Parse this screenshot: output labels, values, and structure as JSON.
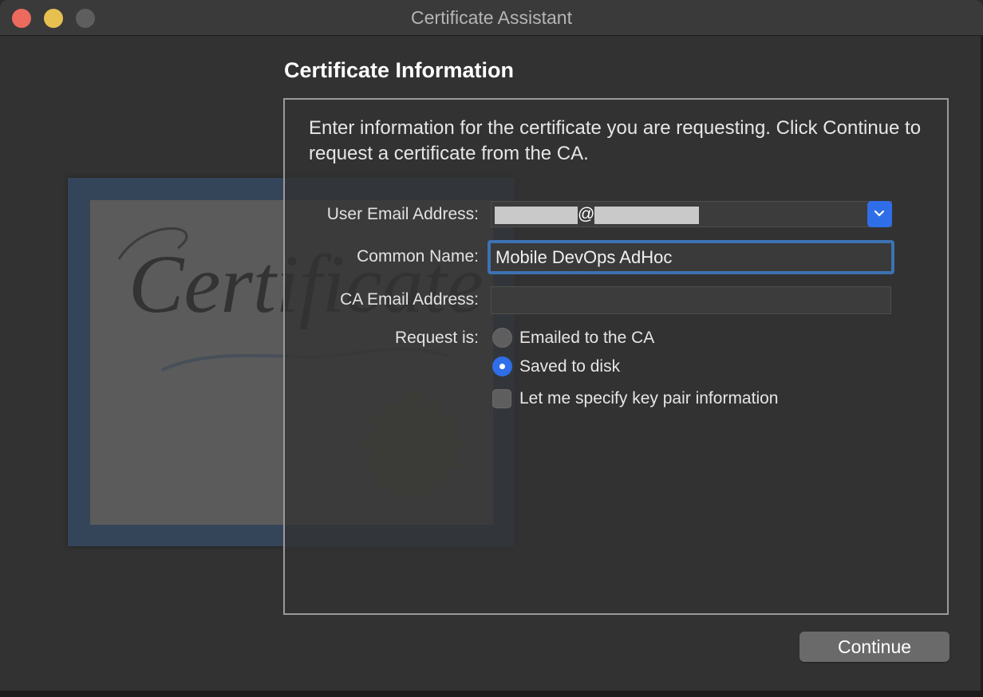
{
  "window": {
    "title": "Certificate Assistant"
  },
  "page": {
    "heading": "Certificate Information",
    "intro": "Enter information for the certificate you are requesting. Click Continue to request a certificate from the CA."
  },
  "form": {
    "user_email_label": "User Email Address:",
    "user_email_separator": "@",
    "common_name_label": "Common Name:",
    "common_name_value": "Mobile DevOps AdHoc",
    "ca_email_label": "CA Email Address:",
    "ca_email_value": "",
    "request_label": "Request is:",
    "request_options": [
      {
        "label": "Emailed to the CA",
        "selected": false
      },
      {
        "label": "Saved to disk",
        "selected": true
      }
    ],
    "key_pair_label": "Let me specify key pair information",
    "key_pair_checked": false
  },
  "artwork": {
    "script_text": "Certificate"
  },
  "footer": {
    "continue_label": "Continue"
  },
  "colors": {
    "accent": "#2f6ee8",
    "focus_ring": "#3d72b3"
  }
}
